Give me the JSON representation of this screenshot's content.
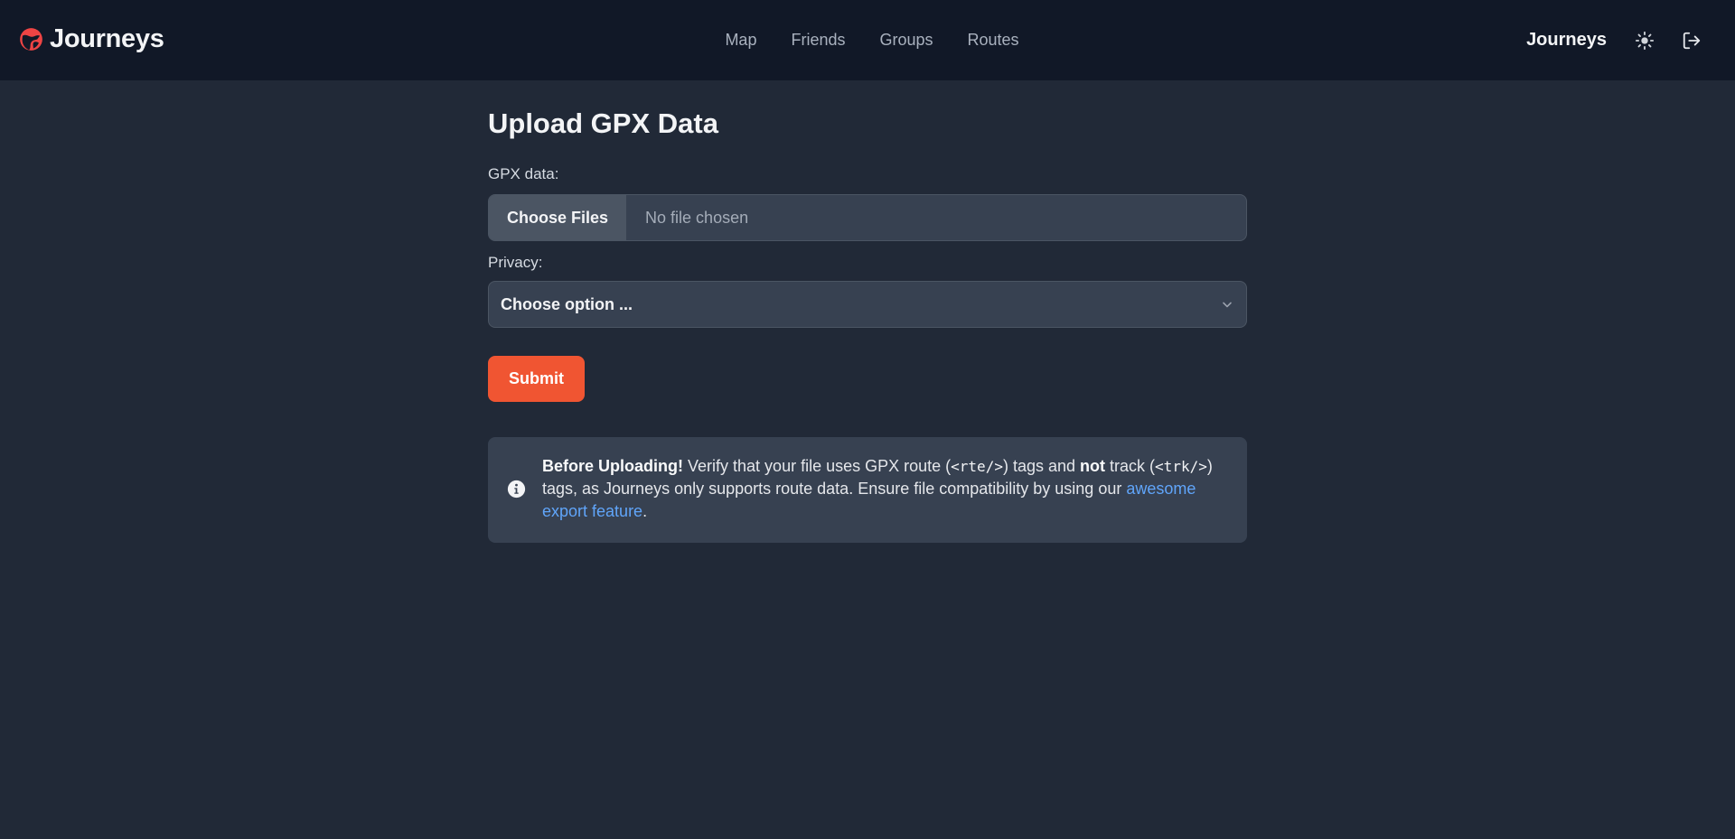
{
  "colors": {
    "page_bg": "#212937",
    "navbar_bg": "#111827",
    "surface": "#374151",
    "accent": "#f05532",
    "link": "#60a5fa"
  },
  "navbar": {
    "brand": {
      "name": "Journeys",
      "icon": "globe-logo-icon"
    },
    "links": [
      {
        "label": "Map"
      },
      {
        "label": "Friends"
      },
      {
        "label": "Groups"
      },
      {
        "label": "Routes"
      }
    ],
    "user_name": "Journeys",
    "theme_icon": "sun-icon",
    "logout_icon": "logout-icon"
  },
  "page": {
    "title": "Upload GPX Data"
  },
  "form": {
    "gpx_label": "GPX data:",
    "file_button": "Choose Files",
    "file_status": "No file chosen",
    "privacy_label": "Privacy:",
    "privacy_value": "Choose option ...",
    "submit_label": "Submit"
  },
  "alert": {
    "icon": "info-icon",
    "bold_lead": "Before Uploading!",
    "text_1": "Verify that your file uses GPX route (",
    "code_rte": "<rte/>",
    "text_2": ") tags and",
    "bold_not": "not",
    "text_3": "track (",
    "code_trk": "<trk/>",
    "text_4": ") tags, as Journeys only supports route data. Ensure file compatibility by using our",
    "link_text": "awesome export feature",
    "text_end": "."
  }
}
